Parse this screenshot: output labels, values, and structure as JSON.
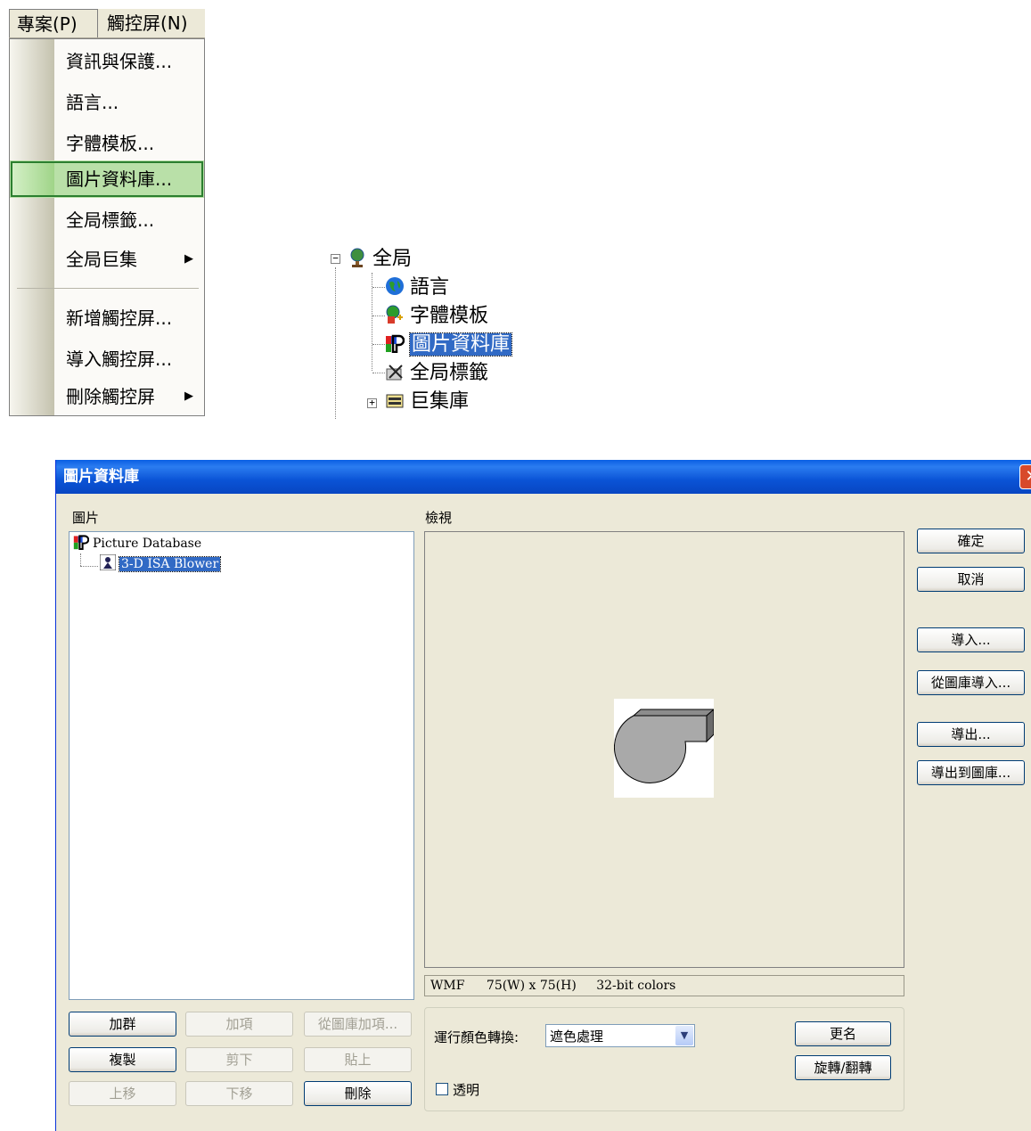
{
  "menu": {
    "titles": [
      "專案(P)",
      "觸控屏(N)"
    ],
    "items": [
      "資訊與保護...",
      "語言...",
      "字體模板...",
      "圖片資料庫...",
      "全局標籤...",
      "全局巨集",
      "新增觸控屏...",
      "導入觸控屏...",
      "刪除觸控屏"
    ],
    "submenu_arrow": "▶"
  },
  "tree": {
    "root": "全局",
    "children": [
      "語言",
      "字體模板",
      "圖片資料庫",
      "全局標籤",
      "巨集庫"
    ],
    "collapse_glyph": "−",
    "expand_glyph": "+"
  },
  "dialog": {
    "title": "圖片資料庫",
    "close_glyph": "✕",
    "pictures_label": "圖片",
    "preview_label": "檢視",
    "tree_root": "Picture Database",
    "tree_item": "3-D ISA Blower",
    "status": {
      "format": "WMF",
      "size": "75(W) x 75(H)",
      "colors": "32-bit colors"
    },
    "right_buttons": [
      "確定",
      "取消",
      "導入...",
      "從圖庫導入...",
      "導出...",
      "導出到圖庫..."
    ],
    "left_buttons": [
      "加群",
      "加項",
      "從圖庫加項...",
      "複製",
      "剪下",
      "貼上",
      "上移",
      "下移",
      "刪除"
    ],
    "color_conversion_label": "運行顏色轉換:",
    "color_conversion_value": "遮色處理",
    "rename_button": "更名",
    "rotate_button": "旋轉/翻轉",
    "transparent_label": "透明"
  },
  "colors": {
    "titlebar": "#0a53d6",
    "dialog_bg": "#ece9d8",
    "selection": "#316ac5",
    "menu_highlight": "#b9e0a8"
  }
}
